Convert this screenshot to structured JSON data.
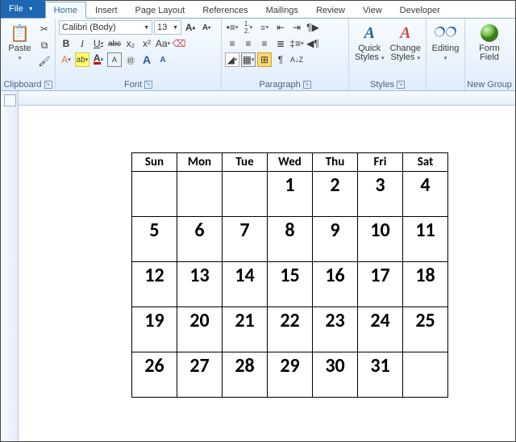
{
  "tabs": {
    "file": "File",
    "items": [
      "Home",
      "Insert",
      "Page Layout",
      "References",
      "Mailings",
      "Review",
      "View",
      "Developer"
    ],
    "active": 0
  },
  "ribbon": {
    "clipboard": {
      "paste": "Paste",
      "label": "Clipboard"
    },
    "font": {
      "family": "Calibri (Body)",
      "size": "13",
      "bold": "B",
      "italic": "I",
      "underline": "U",
      "strike": "abc",
      "sub": "x₂",
      "sup": "x²",
      "clearfmt": "Aa",
      "case": "Aa",
      "grow": "A",
      "shrink": "A",
      "highlight": "ab",
      "fontcolor": "A",
      "charborder": "A",
      "label": "Font"
    },
    "paragraph": {
      "label": "Paragraph"
    },
    "styles": {
      "quick": "Quick Styles",
      "change": "Change Styles",
      "label": "Styles"
    },
    "editing": {
      "find": "Editing",
      "label": ""
    },
    "newgroup": {
      "btn": "Form Field",
      "label": "New Group"
    }
  },
  "calendar": {
    "headers": [
      "Sun",
      "Mon",
      "Tue",
      "Wed",
      "Thu",
      "Fri",
      "Sat"
    ],
    "rows": [
      [
        "",
        "",
        "",
        "1",
        "2",
        "3",
        "4"
      ],
      [
        "5",
        "6",
        "7",
        "8",
        "9",
        "10",
        "11"
      ],
      [
        "12",
        "13",
        "14",
        "15",
        "16",
        "17",
        "18"
      ],
      [
        "19",
        "20",
        "21",
        "22",
        "23",
        "24",
        "25"
      ],
      [
        "26",
        "27",
        "28",
        "29",
        "30",
        "31",
        ""
      ]
    ]
  }
}
